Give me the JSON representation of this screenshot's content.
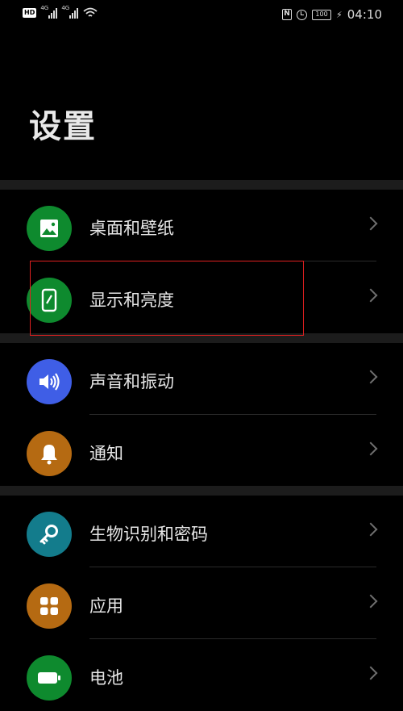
{
  "status_bar": {
    "hd": "HD",
    "sim1": "4G",
    "sim2": "4G",
    "battery": "100",
    "time": "04:10",
    "icons": [
      "hd-icon",
      "signal-icon",
      "signal-icon",
      "wifi-icon",
      "nfc-icon",
      "alarm-icon",
      "battery-icon",
      "charging-icon"
    ]
  },
  "page": {
    "title": "设置"
  },
  "settings": [
    {
      "label": "桌面和壁纸",
      "icon": "wallpaper-icon",
      "color": "#0e8a2e"
    },
    {
      "label": "显示和亮度",
      "icon": "phone-display-icon",
      "color": "#0e8a2e"
    },
    {
      "label": "声音和振动",
      "icon": "volume-icon",
      "color": "#3f5ee6"
    },
    {
      "label": "通知",
      "icon": "bell-icon",
      "color": "#b56a12"
    },
    {
      "label": "生物识别和密码",
      "icon": "key-icon",
      "color": "#137c8c"
    },
    {
      "label": "应用",
      "icon": "apps-grid-icon",
      "color": "#b56a12"
    },
    {
      "label": "电池",
      "icon": "battery-icon",
      "color": "#0e8a2e"
    }
  ],
  "highlight_color": "#e02020"
}
